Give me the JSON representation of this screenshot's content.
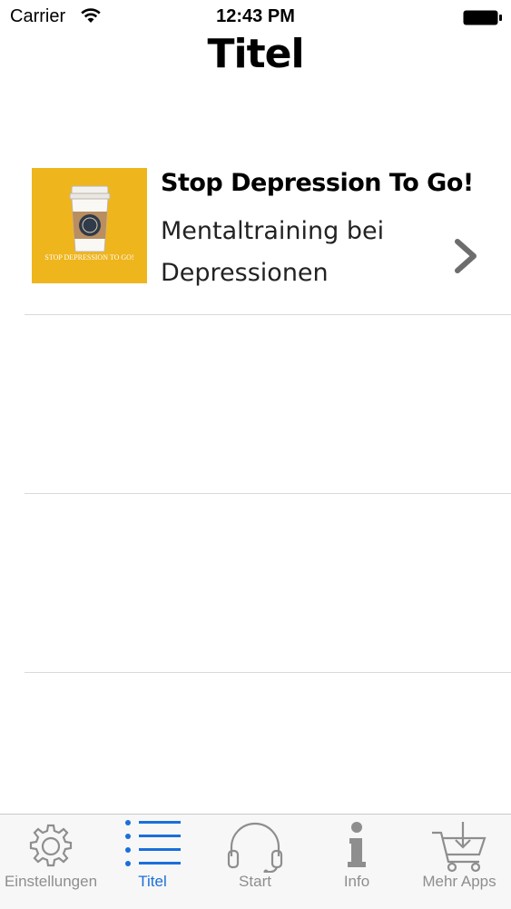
{
  "status_bar": {
    "carrier": "Carrier",
    "time": "12:43 PM"
  },
  "nav": {
    "title": "Titel"
  },
  "list": {
    "items": [
      {
        "title": "Stop Depression To Go!",
        "subtitle": "Mentaltraining bei Depressionen",
        "thumbnail_text": "STOP DEPRESSION TO GO!",
        "thumbnail_color": "#efb51d"
      }
    ]
  },
  "tab_bar": {
    "tabs": [
      {
        "label": "Einstellungen",
        "icon": "gear-icon",
        "active": false
      },
      {
        "label": "Titel",
        "icon": "list-icon",
        "active": true
      },
      {
        "label": "Start",
        "icon": "headphones-icon",
        "active": false
      },
      {
        "label": "Info",
        "icon": "info-icon",
        "active": false
      },
      {
        "label": "Mehr Apps",
        "icon": "cart-icon",
        "active": false
      }
    ],
    "active_color": "#1a6fdb",
    "inactive_color": "#8e8e8e"
  }
}
